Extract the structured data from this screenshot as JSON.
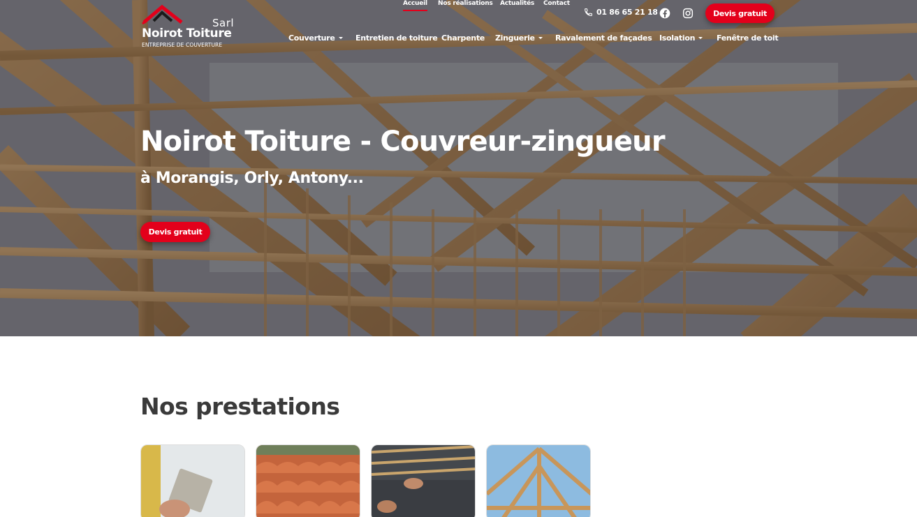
{
  "logo": {
    "sarl": "Sarl",
    "name": "Noirot Toiture",
    "tagline": "ENTREPRISE DE COUVERTURE"
  },
  "top_nav": {
    "links": [
      "Accueil",
      "Nos réalisations",
      "Actualités",
      "Contact"
    ],
    "active": "Accueil",
    "phone": "01 86 65 21 18",
    "cta": "Devis gratuit"
  },
  "main_nav": {
    "items": [
      {
        "label": "Couverture",
        "dropdown": true
      },
      {
        "label": "Entretien de toiture",
        "dropdown": false
      },
      {
        "label": "Charpente",
        "dropdown": false
      },
      {
        "label": "Zinguerie",
        "dropdown": true
      },
      {
        "label": "Ravalement de façades",
        "dropdown": false
      },
      {
        "label": "Isolation",
        "dropdown": true
      },
      {
        "label": "Fenêtre de toit",
        "dropdown": false
      }
    ]
  },
  "hero": {
    "title": "Noirot Toiture - Couvreur-zingueur",
    "subtitle": "à Morangis, Orly, Antony...",
    "cta": "Devis gratuit"
  },
  "services": {
    "title": "Nos prestations",
    "cards": [
      "ravalement-image",
      "tuiles-image",
      "ardoise-image",
      "charpente-image"
    ]
  },
  "colors": {
    "accent": "#e3001b",
    "heading": "#3a3a3a"
  },
  "icons": [
    "phone-icon",
    "facebook-icon",
    "instagram-icon",
    "caret-down-icon"
  ]
}
